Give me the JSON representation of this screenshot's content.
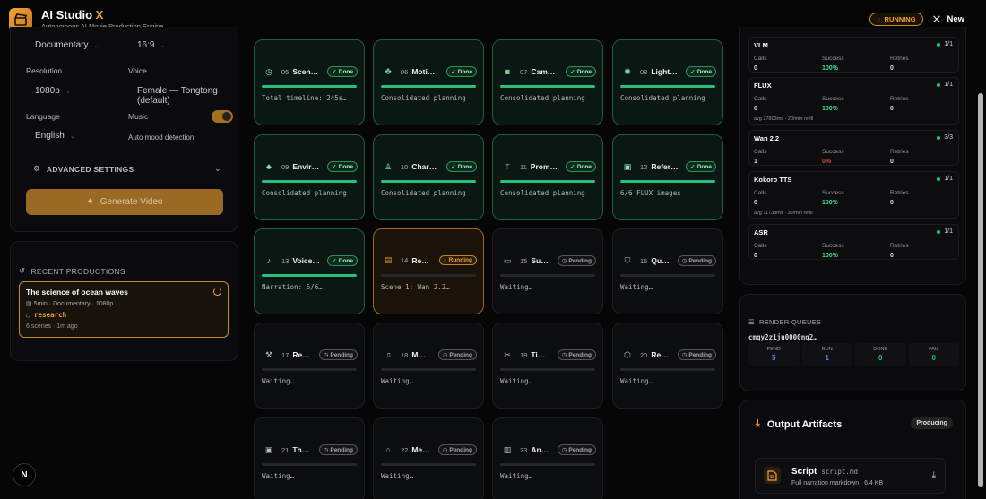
{
  "header": {
    "title_main": "AI Studio",
    "title_accent": "X",
    "subtitle": "Autonomous AI Movie Production Engine",
    "status": "RUNNING",
    "new_label": "New"
  },
  "settings": {
    "style_value": "Documentary",
    "aspect_value": "16:9",
    "resolution_label": "Resolution",
    "resolution_value": "1080p",
    "voice_label": "Voice",
    "voice_value": "Female — Tongtong (default)",
    "language_label": "Language",
    "language_value": "English",
    "music_label": "Music",
    "music_note": "Auto mood detection",
    "music_on": true,
    "advanced_label": "ADVANCED SETTINGS",
    "generate_label": "Generate Video"
  },
  "recent": {
    "heading": "RECENT PRODUCTIONS",
    "item": {
      "title": "The science of ocean waves",
      "meta": "5min · Documentary · 1080p",
      "step": "research",
      "footer": "6 scenes · 1m ago"
    }
  },
  "steps": [
    {
      "num": "05",
      "name": "Scen…",
      "status": "Done",
      "note": "Total timeline: 245s…",
      "icon": "clock-icon"
    },
    {
      "num": "06",
      "name": "Moti…",
      "status": "Done",
      "note": "Consolidated planning",
      "icon": "move-icon"
    },
    {
      "num": "07",
      "name": "Cam…",
      "status": "Done",
      "note": "Consolidated planning",
      "icon": "camera-icon"
    },
    {
      "num": "08",
      "name": "Light…",
      "status": "Done",
      "note": "Consolidated planning",
      "icon": "sun-icon"
    },
    {
      "num": "09",
      "name": "Envir…",
      "status": "Done",
      "note": "Consolidated planning",
      "icon": "trees-icon"
    },
    {
      "num": "10",
      "name": "Char…",
      "status": "Done",
      "note": "Consolidated planning",
      "icon": "user-icon"
    },
    {
      "num": "11",
      "name": "Prom…",
      "status": "Done",
      "note": "Consolidated planning",
      "icon": "wand-icon"
    },
    {
      "num": "12",
      "name": "Refer…",
      "status": "Done",
      "note": "6/6 FLUX images",
      "icon": "image-icon"
    },
    {
      "num": "13",
      "name": "Voice…",
      "status": "Done",
      "note": "Narration: 6/6…",
      "icon": "mic-icon"
    },
    {
      "num": "14",
      "name": "Re…",
      "status": "Running",
      "note": "Scene 1: Wan 2.2…",
      "icon": "film-icon"
    },
    {
      "num": "15",
      "name": "Su…",
      "status": "Pending",
      "note": "Waiting…",
      "icon": "subtitles-icon"
    },
    {
      "num": "16",
      "name": "Qu…",
      "status": "Pending",
      "note": "Waiting…",
      "icon": "shield-icon"
    },
    {
      "num": "17",
      "name": "Re…",
      "status": "Pending",
      "note": "Waiting…",
      "icon": "wrench-icon"
    },
    {
      "num": "18",
      "name": "M…",
      "status": "Pending",
      "note": "Waiting…",
      "icon": "music-icon"
    },
    {
      "num": "19",
      "name": "Ti…",
      "status": "Pending",
      "note": "Waiting…",
      "icon": "scissors-icon"
    },
    {
      "num": "20",
      "name": "Re…",
      "status": "Pending",
      "note": "Waiting…",
      "icon": "box-icon"
    },
    {
      "num": "21",
      "name": "Th…",
      "status": "Pending",
      "note": "Waiting…",
      "icon": "image-icon"
    },
    {
      "num": "22",
      "name": "Me…",
      "status": "Pending",
      "note": "Waiting…",
      "icon": "tag-icon"
    },
    {
      "num": "23",
      "name": "An…",
      "status": "Pending",
      "note": "Waiting…",
      "icon": "bar-chart-icon"
    }
  ],
  "models": {
    "labels": {
      "calls": "Calls",
      "success": "Success",
      "retries": "Retries"
    },
    "items": [
      {
        "name": "VLM",
        "count": "1/1",
        "calls": "0",
        "success": "100%",
        "retries": "0",
        "avg": ""
      },
      {
        "name": "FLUX",
        "count": "1/1",
        "calls": "6",
        "success": "100%",
        "retries": "0",
        "avg": "avg 27803ms · 20/min refill"
      },
      {
        "name": "Wan 2.2",
        "count": "3/3",
        "calls": "1",
        "success": "0%",
        "retries": "0",
        "avg": ""
      },
      {
        "name": "Kokoro TTS",
        "count": "1/1",
        "calls": "6",
        "success": "100%",
        "retries": "0",
        "avg": "avg 11738ms · 30/min refill"
      },
      {
        "name": "ASR",
        "count": "1/1",
        "calls": "0",
        "success": "100%",
        "retries": "0",
        "avg": ""
      }
    ]
  },
  "queues": {
    "heading": "RENDER QUEUES",
    "id": "cmqy2z1ju0000nq2…",
    "cells": [
      {
        "key": "PEND",
        "value": "5",
        "color": "#4f8cff"
      },
      {
        "key": "RUN",
        "value": "1",
        "color": "#4f8cff"
      },
      {
        "key": "DONE",
        "value": "0",
        "color": "#26c07a"
      },
      {
        "key": "FAIL",
        "value": "0",
        "color": "#26c07a"
      }
    ]
  },
  "artifacts": {
    "title": "Output Artifacts",
    "status": "Producing",
    "item": {
      "name": "Script",
      "file": "script.md",
      "desc": "Full narration markdown",
      "size": "6.4 KB"
    }
  },
  "colors": {
    "accent": "#f0a335",
    "done": "#26c07a",
    "fail": "#e0463c"
  }
}
